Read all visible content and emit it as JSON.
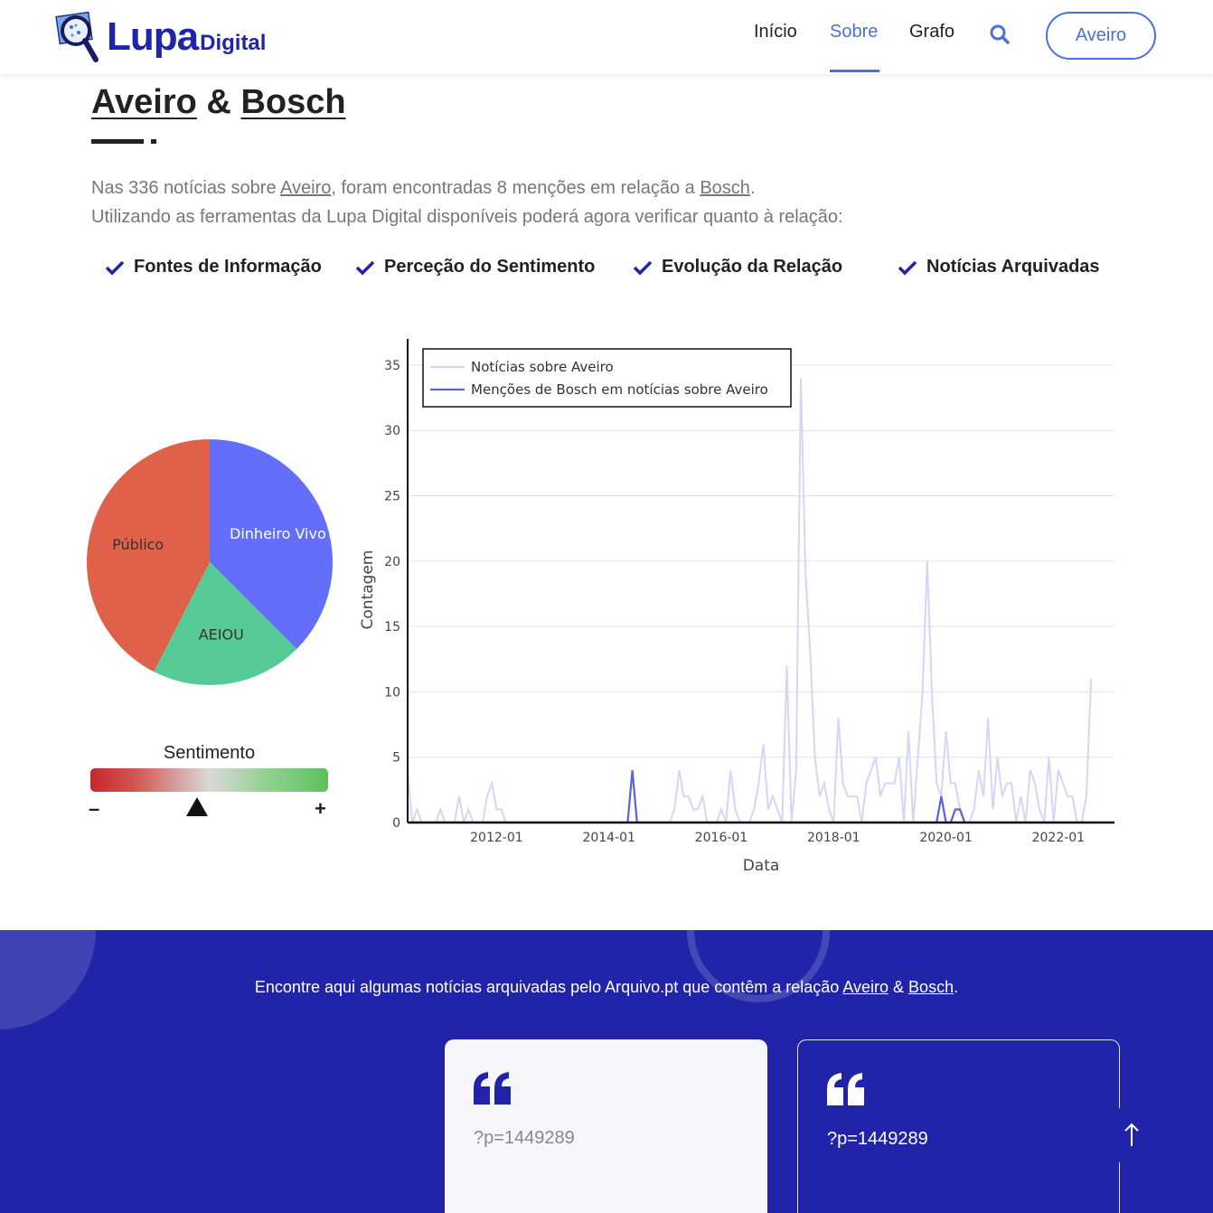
{
  "header": {
    "logo_main": "Lupa",
    "logo_sub": "Digital",
    "nav": [
      {
        "label": "Início"
      },
      {
        "label": "Sobre"
      },
      {
        "label": "Grafo"
      }
    ],
    "location_button": "Aveiro",
    "icons": {
      "search": "search-icon",
      "logo": "magnifier-logo-icon"
    }
  },
  "title": {
    "entity_a": "Aveiro",
    "amp": "&",
    "entity_b": "Bosch"
  },
  "description": {
    "line1_pre": "Nas 336 notícias sobre ",
    "line1_a": "Aveiro",
    "line1_mid": ", foram encontradas 8 menções em relação a ",
    "line1_b": "Bosch",
    "line1_end": ".",
    "line2": "Utilizando as ferramentas da Lupa Digital disponíveis poderá agora verificar quanto à relação:"
  },
  "features": [
    {
      "label": "Fontes de Informação"
    },
    {
      "label": "Perceção do Sentimento"
    },
    {
      "label": "Evolução da Relação"
    },
    {
      "label": "Notícias Arquivadas"
    }
  ],
  "sources_pie": {
    "type": "pie",
    "slices": [
      {
        "label": "Dinheiro Vivo",
        "share": 0.375,
        "color": "#636efa"
      },
      {
        "label": "AEIOU",
        "share": 0.2,
        "color": "#57cb95"
      },
      {
        "label": "Público",
        "share": 0.425,
        "color": "#e0614a"
      }
    ]
  },
  "sentiment": {
    "title": "Sentimento",
    "minus": "–",
    "plus": "+",
    "level": 0.45
  },
  "chart_data": {
    "type": "line",
    "xlabel": "Data",
    "ylabel": "Contagem",
    "ylim": [
      0,
      37
    ],
    "yticks": [
      0,
      5,
      10,
      15,
      20,
      25,
      30,
      35
    ],
    "xticks": [
      "2012-01",
      "2014-01",
      "2016-01",
      "2018-01",
      "2020-01",
      "2022-01"
    ],
    "xlim": [
      "2010-06",
      "2023-01"
    ],
    "legend_position": "top-left",
    "grid": true,
    "series": [
      {
        "name": "Notícias sobre Aveiro",
        "color": "#d5d6f5",
        "points": [
          [
            "2010-06",
            4
          ],
          [
            "2010-07",
            0
          ],
          [
            "2010-08",
            1
          ],
          [
            "2010-09",
            0
          ],
          [
            "2010-10",
            0
          ],
          [
            "2010-11",
            0
          ],
          [
            "2010-12",
            0
          ],
          [
            "2011-01",
            1
          ],
          [
            "2011-02",
            0
          ],
          [
            "2011-03",
            0
          ],
          [
            "2011-04",
            0
          ],
          [
            "2011-05",
            2
          ],
          [
            "2011-06",
            0
          ],
          [
            "2011-07",
            1
          ],
          [
            "2011-08",
            0
          ],
          [
            "2011-09",
            0
          ],
          [
            "2011-10",
            0
          ],
          [
            "2011-11",
            2
          ],
          [
            "2011-12",
            3
          ],
          [
            "2012-01",
            1
          ],
          [
            "2012-02",
            1
          ],
          [
            "2012-03",
            0
          ],
          [
            "2012-04",
            0
          ],
          [
            "2014-06",
            0
          ],
          [
            "2015-02",
            0
          ],
          [
            "2015-03",
            1
          ],
          [
            "2015-04",
            4
          ],
          [
            "2015-05",
            2
          ],
          [
            "2015-06",
            2
          ],
          [
            "2015-07",
            1
          ],
          [
            "2015-08",
            1
          ],
          [
            "2015-09",
            2
          ],
          [
            "2015-10",
            0
          ],
          [
            "2015-11",
            0
          ],
          [
            "2015-12",
            0
          ],
          [
            "2016-01",
            1
          ],
          [
            "2016-02",
            0
          ],
          [
            "2016-03",
            4
          ],
          [
            "2016-04",
            1
          ],
          [
            "2016-05",
            0
          ],
          [
            "2016-06",
            0
          ],
          [
            "2016-07",
            0
          ],
          [
            "2016-08",
            1
          ],
          [
            "2016-09",
            3
          ],
          [
            "2016-10",
            6
          ],
          [
            "2016-11",
            1
          ],
          [
            "2016-12",
            2
          ],
          [
            "2017-01",
            1
          ],
          [
            "2017-02",
            0
          ],
          [
            "2017-03",
            12
          ],
          [
            "2017-04",
            0
          ],
          [
            "2017-05",
            4
          ],
          [
            "2017-06",
            34
          ],
          [
            "2017-07",
            19
          ],
          [
            "2017-08",
            13
          ],
          [
            "2017-09",
            5
          ],
          [
            "2017-10",
            2
          ],
          [
            "2017-11",
            3
          ],
          [
            "2017-12",
            1
          ],
          [
            "2018-01",
            0
          ],
          [
            "2018-02",
            8
          ],
          [
            "2018-03",
            3
          ],
          [
            "2018-04",
            2
          ],
          [
            "2018-05",
            2
          ],
          [
            "2018-06",
            2
          ],
          [
            "2018-07",
            0
          ],
          [
            "2018-08",
            3
          ],
          [
            "2018-09",
            4
          ],
          [
            "2018-10",
            5
          ],
          [
            "2018-11",
            2
          ],
          [
            "2018-12",
            3
          ],
          [
            "2019-01",
            3
          ],
          [
            "2019-02",
            3
          ],
          [
            "2019-03",
            5
          ],
          [
            "2019-04",
            0
          ],
          [
            "2019-05",
            7
          ],
          [
            "2019-06",
            0
          ],
          [
            "2019-07",
            5
          ],
          [
            "2019-08",
            10
          ],
          [
            "2019-09",
            20
          ],
          [
            "2019-10",
            10
          ],
          [
            "2019-11",
            3
          ],
          [
            "2019-12",
            2
          ],
          [
            "2020-01",
            7
          ],
          [
            "2020-02",
            3
          ],
          [
            "2020-03",
            3
          ],
          [
            "2020-04",
            1
          ],
          [
            "2020-05",
            0
          ],
          [
            "2020-06",
            0
          ],
          [
            "2020-07",
            1
          ],
          [
            "2020-08",
            4
          ],
          [
            "2020-09",
            2
          ],
          [
            "2020-10",
            8
          ],
          [
            "2020-11",
            1
          ],
          [
            "2020-12",
            5
          ],
          [
            "2021-01",
            2
          ],
          [
            "2021-02",
            3
          ],
          [
            "2021-03",
            3
          ],
          [
            "2021-04",
            0
          ],
          [
            "2021-05",
            2
          ],
          [
            "2021-06",
            0
          ],
          [
            "2021-07",
            4
          ],
          [
            "2021-08",
            3
          ],
          [
            "2021-09",
            1
          ],
          [
            "2021-10",
            0
          ],
          [
            "2021-11",
            5
          ],
          [
            "2021-12",
            0
          ],
          [
            "2022-01",
            4
          ],
          [
            "2022-02",
            3
          ],
          [
            "2022-03",
            2
          ],
          [
            "2022-04",
            2
          ],
          [
            "2022-05",
            0
          ],
          [
            "2022-06",
            0
          ],
          [
            "2022-07",
            2
          ],
          [
            "2022-08",
            11
          ]
        ]
      },
      {
        "name": "Menções de Bosch em notícias sobre Aveiro",
        "color": "#5a62de",
        "points": [
          [
            "2010-06",
            0
          ],
          [
            "2014-05",
            0
          ],
          [
            "2014-06",
            4
          ],
          [
            "2014-07",
            0
          ],
          [
            "2019-11",
            0
          ],
          [
            "2019-12",
            2
          ],
          [
            "2020-01",
            0
          ],
          [
            "2020-02",
            0
          ],
          [
            "2020-03",
            1
          ],
          [
            "2020-04",
            1
          ],
          [
            "2020-05",
            0
          ],
          [
            "2022-08",
            0
          ]
        ]
      }
    ]
  },
  "archive": {
    "text_pre": "Encontre aqui algumas notícias arquivadas pelo Arquivo.pt que contêm a relação ",
    "entity_a": "Aveiro",
    "amp": " & ",
    "entity_b": "Bosch",
    "text_end": ".",
    "cards": [
      {
        "text": "?p=1449289"
      },
      {
        "text": "?p=1449289"
      }
    ],
    "icons": {
      "quote": "quote-icon",
      "scroll_top": "arrow-up-icon"
    }
  }
}
